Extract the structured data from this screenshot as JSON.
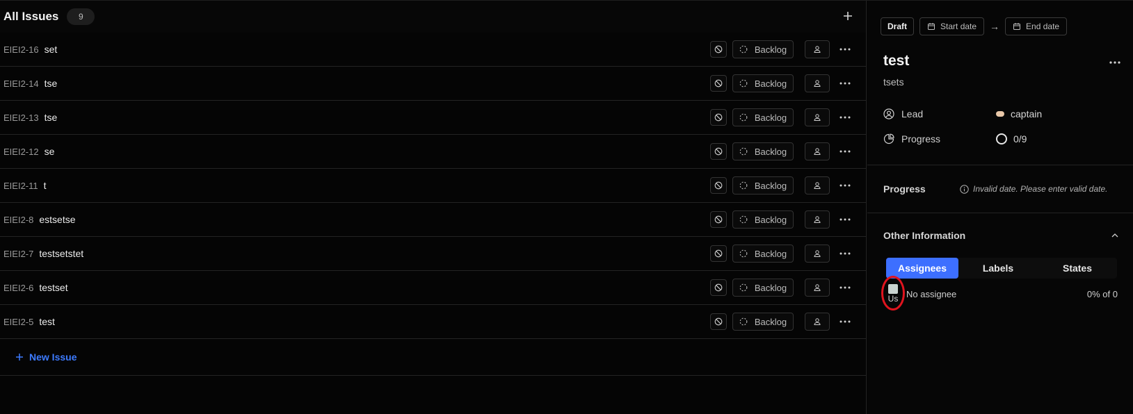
{
  "list": {
    "title": "All Issues",
    "count": "9",
    "add_icon": "plus-icon",
    "new_issue_label": "New Issue",
    "issues": [
      {
        "id": "EIEI2-16",
        "name": "set",
        "state": "Backlog"
      },
      {
        "id": "EIEI2-14",
        "name": "tse",
        "state": "Backlog"
      },
      {
        "id": "EIEI2-13",
        "name": "tse",
        "state": "Backlog"
      },
      {
        "id": "EIEI2-12",
        "name": "se",
        "state": "Backlog"
      },
      {
        "id": "EIEI2-11",
        "name": "t",
        "state": "Backlog"
      },
      {
        "id": "EIEI2-8",
        "name": "estsetse",
        "state": "Backlog"
      },
      {
        "id": "EIEI2-7",
        "name": "testsetstet",
        "state": "Backlog"
      },
      {
        "id": "EIEI2-6",
        "name": "testset",
        "state": "Backlog"
      },
      {
        "id": "EIEI2-5",
        "name": "test",
        "state": "Backlog"
      }
    ]
  },
  "panel": {
    "status": "Draft",
    "start_date_placeholder": "Start date",
    "end_date_placeholder": "End date",
    "arrow": "→",
    "title": "test",
    "description": "tsets",
    "lead_label": "Lead",
    "lead_value": "captain",
    "progress_label": "Progress",
    "progress_value": "0/9",
    "progress_section_label": "Progress",
    "invalid_date_message": "Invalid date. Please enter valid date.",
    "other_info_label": "Other Information",
    "tabs": [
      {
        "label": "Assignees",
        "active": true
      },
      {
        "label": "Labels",
        "active": false
      },
      {
        "label": "States",
        "active": false
      }
    ],
    "assignee_alt": "Us",
    "no_assignee_label": "No assignee",
    "assignee_pct": "0% of 0"
  },
  "colors": {
    "accent": "#3d6fff",
    "link": "#3d7bff",
    "highlight": "#e0141e",
    "background": "#050505"
  }
}
